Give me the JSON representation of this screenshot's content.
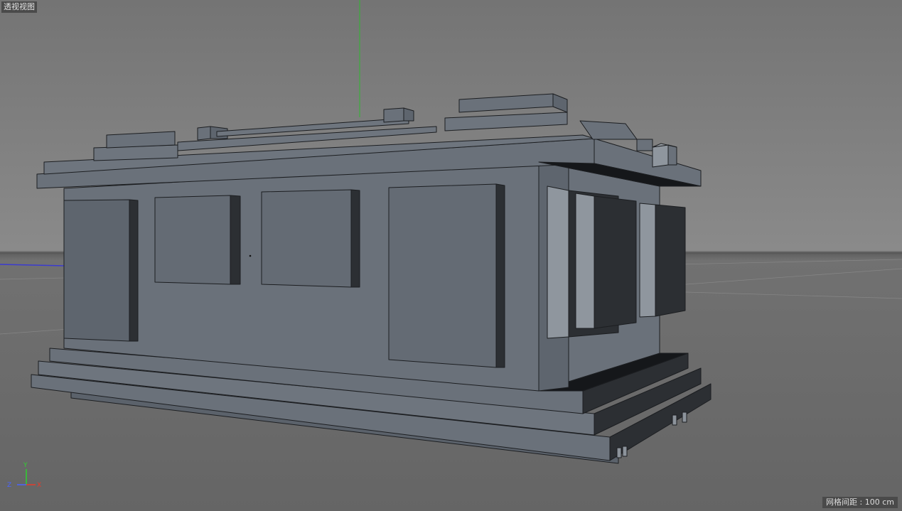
{
  "viewport": {
    "label": "透视视图",
    "grid_info": "网格间距 : 100 cm"
  },
  "axis_gizmo": {
    "y_label": "Y",
    "z_label": "Z",
    "x_label": "X",
    "y_color": "#2fd02f",
    "z_color": "#4a63ff",
    "x_color": "#e33b2b"
  },
  "scene": {
    "object": "building-model",
    "y_axis_color": "#2fb82f",
    "x_axis_color": "#3b3bd0",
    "background_top": "#7a7a7a",
    "background_horizon": "#8a8a8a",
    "ground_color": "#6b6b6b",
    "model_face_color": "#6a717a",
    "model_shadow_color": "#2c2f33"
  }
}
